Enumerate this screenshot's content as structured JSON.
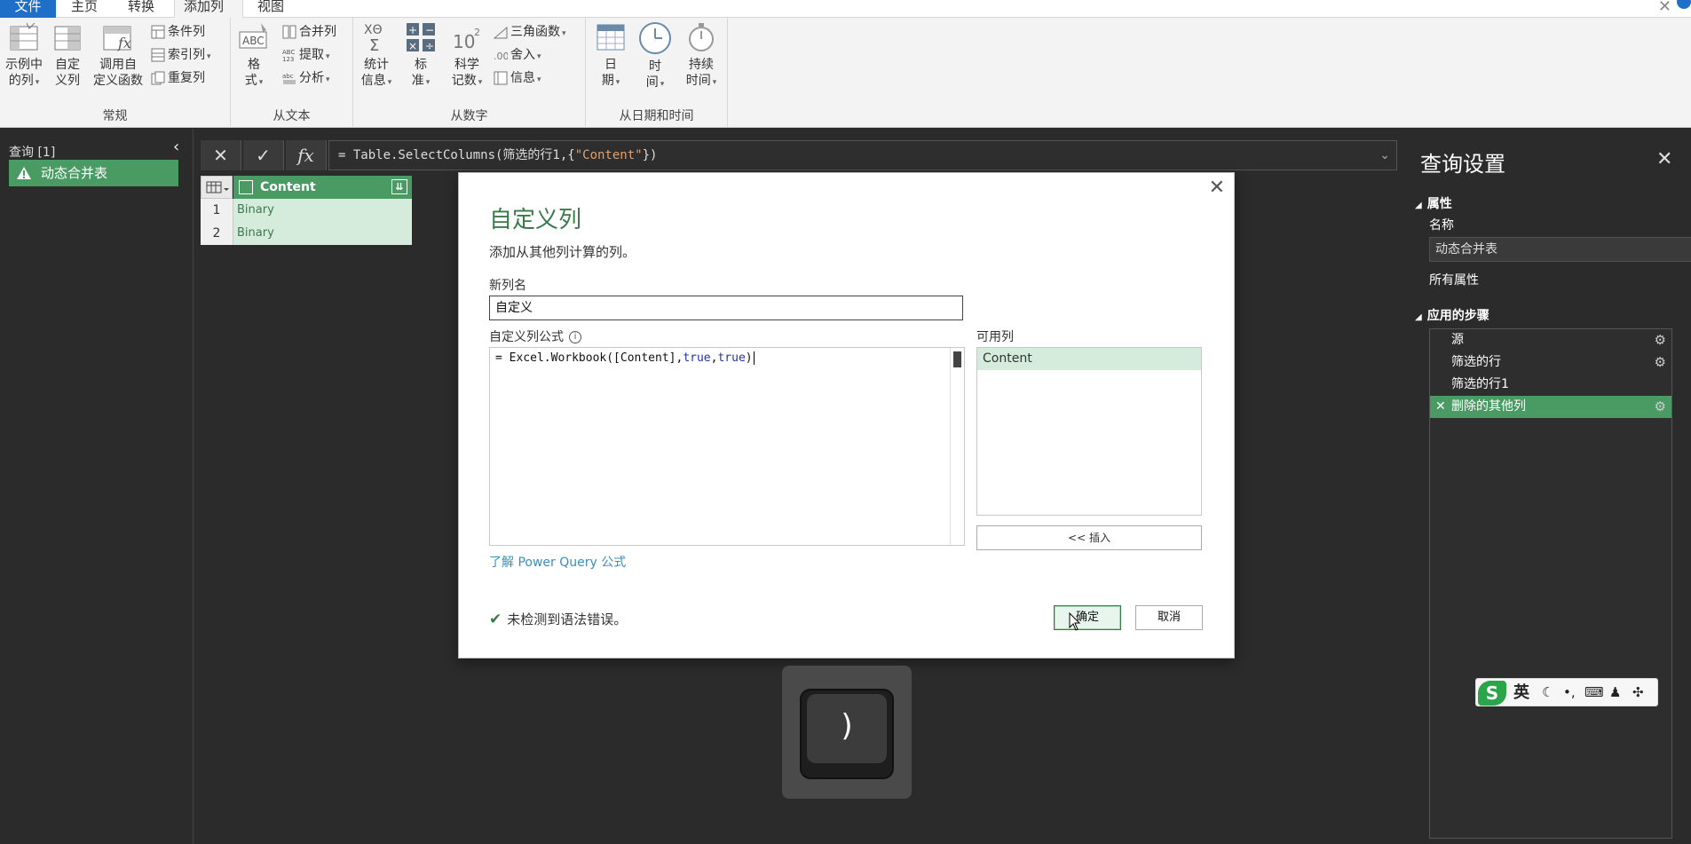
{
  "tabs": [
    {
      "label": "文件"
    },
    {
      "label": "主页"
    },
    {
      "label": "转换"
    },
    {
      "label": "添加列"
    },
    {
      "label": "视图"
    }
  ],
  "ribbon": {
    "groups": {
      "general": "常规",
      "from_text": "从文本",
      "from_number": "从数字",
      "from_datetime": "从日期和时间"
    },
    "buttons": {
      "example_col_1": "示例中",
      "example_col_2": "的列",
      "custom_col_1": "自定",
      "custom_col_2": "义列",
      "invoke_fn_1": "调用自",
      "invoke_fn_2": "定义函数",
      "conditional_col": "条件列",
      "index_col": "索引列",
      "duplicate_col": "重复列",
      "format_1": "格",
      "format_2": "式",
      "merge_cols": "合并列",
      "extract": "提取",
      "parse": "分析",
      "statistics_1": "统计",
      "statistics_2": "信息",
      "standard_1": "标",
      "standard_2": "准",
      "scientific_1": "科学",
      "scientific_2": "记数",
      "trig": "三角函数",
      "rounding": "舍入",
      "information": "信息",
      "date_1": "日",
      "date_2": "期",
      "time_1": "时",
      "time_2": "间",
      "duration_1": "持续",
      "duration_2": "时间"
    }
  },
  "left_pane": {
    "title": "查询 [1]",
    "query_name": "动态合并表"
  },
  "formula_bar": {
    "prefix": "= Table.SelectColumns(筛选的行1,{",
    "string": "\"Content\"",
    "suffix": "})"
  },
  "grid": {
    "column": "Content",
    "rows": [
      {
        "num": "1",
        "value": "Binary"
      },
      {
        "num": "2",
        "value": "Binary"
      }
    ]
  },
  "right_pane": {
    "title": "查询设置",
    "properties_label": "属性",
    "name_label": "名称",
    "name_value": "动态合并表",
    "all_properties": "所有属性",
    "steps_label": "应用的步骤",
    "steps": [
      {
        "name": "源"
      },
      {
        "name": "筛选的行"
      },
      {
        "name": "筛选的行1"
      },
      {
        "name": "删除的其他列"
      }
    ]
  },
  "dialog": {
    "title": "自定义列",
    "description": "添加从其他列计算的列。",
    "new_name_label": "新列名",
    "new_name_value": "自定义",
    "formula_label": "自定义列公式",
    "formula": {
      "part1": "= Excel.Workbook([Content],",
      "kw1": "true",
      "comma": ",",
      "kw2": "true",
      "close": ")"
    },
    "available_label": "可用列",
    "available_columns": [
      "Content"
    ],
    "insert_button": "<< 插入",
    "learn_link": "了解 Power Query 公式",
    "status": "未检测到语法错误。",
    "ok_button": "确定",
    "cancel_button": "取消"
  },
  "key_overlay": {
    "key": ")"
  },
  "ime": {
    "lang": "英"
  },
  "colors": {
    "accent_green": "#4a9a63",
    "file_tab_blue": "#1e6fc7",
    "dark_background": "#2b2b2b",
    "link_blue": "#3a8fb7"
  }
}
